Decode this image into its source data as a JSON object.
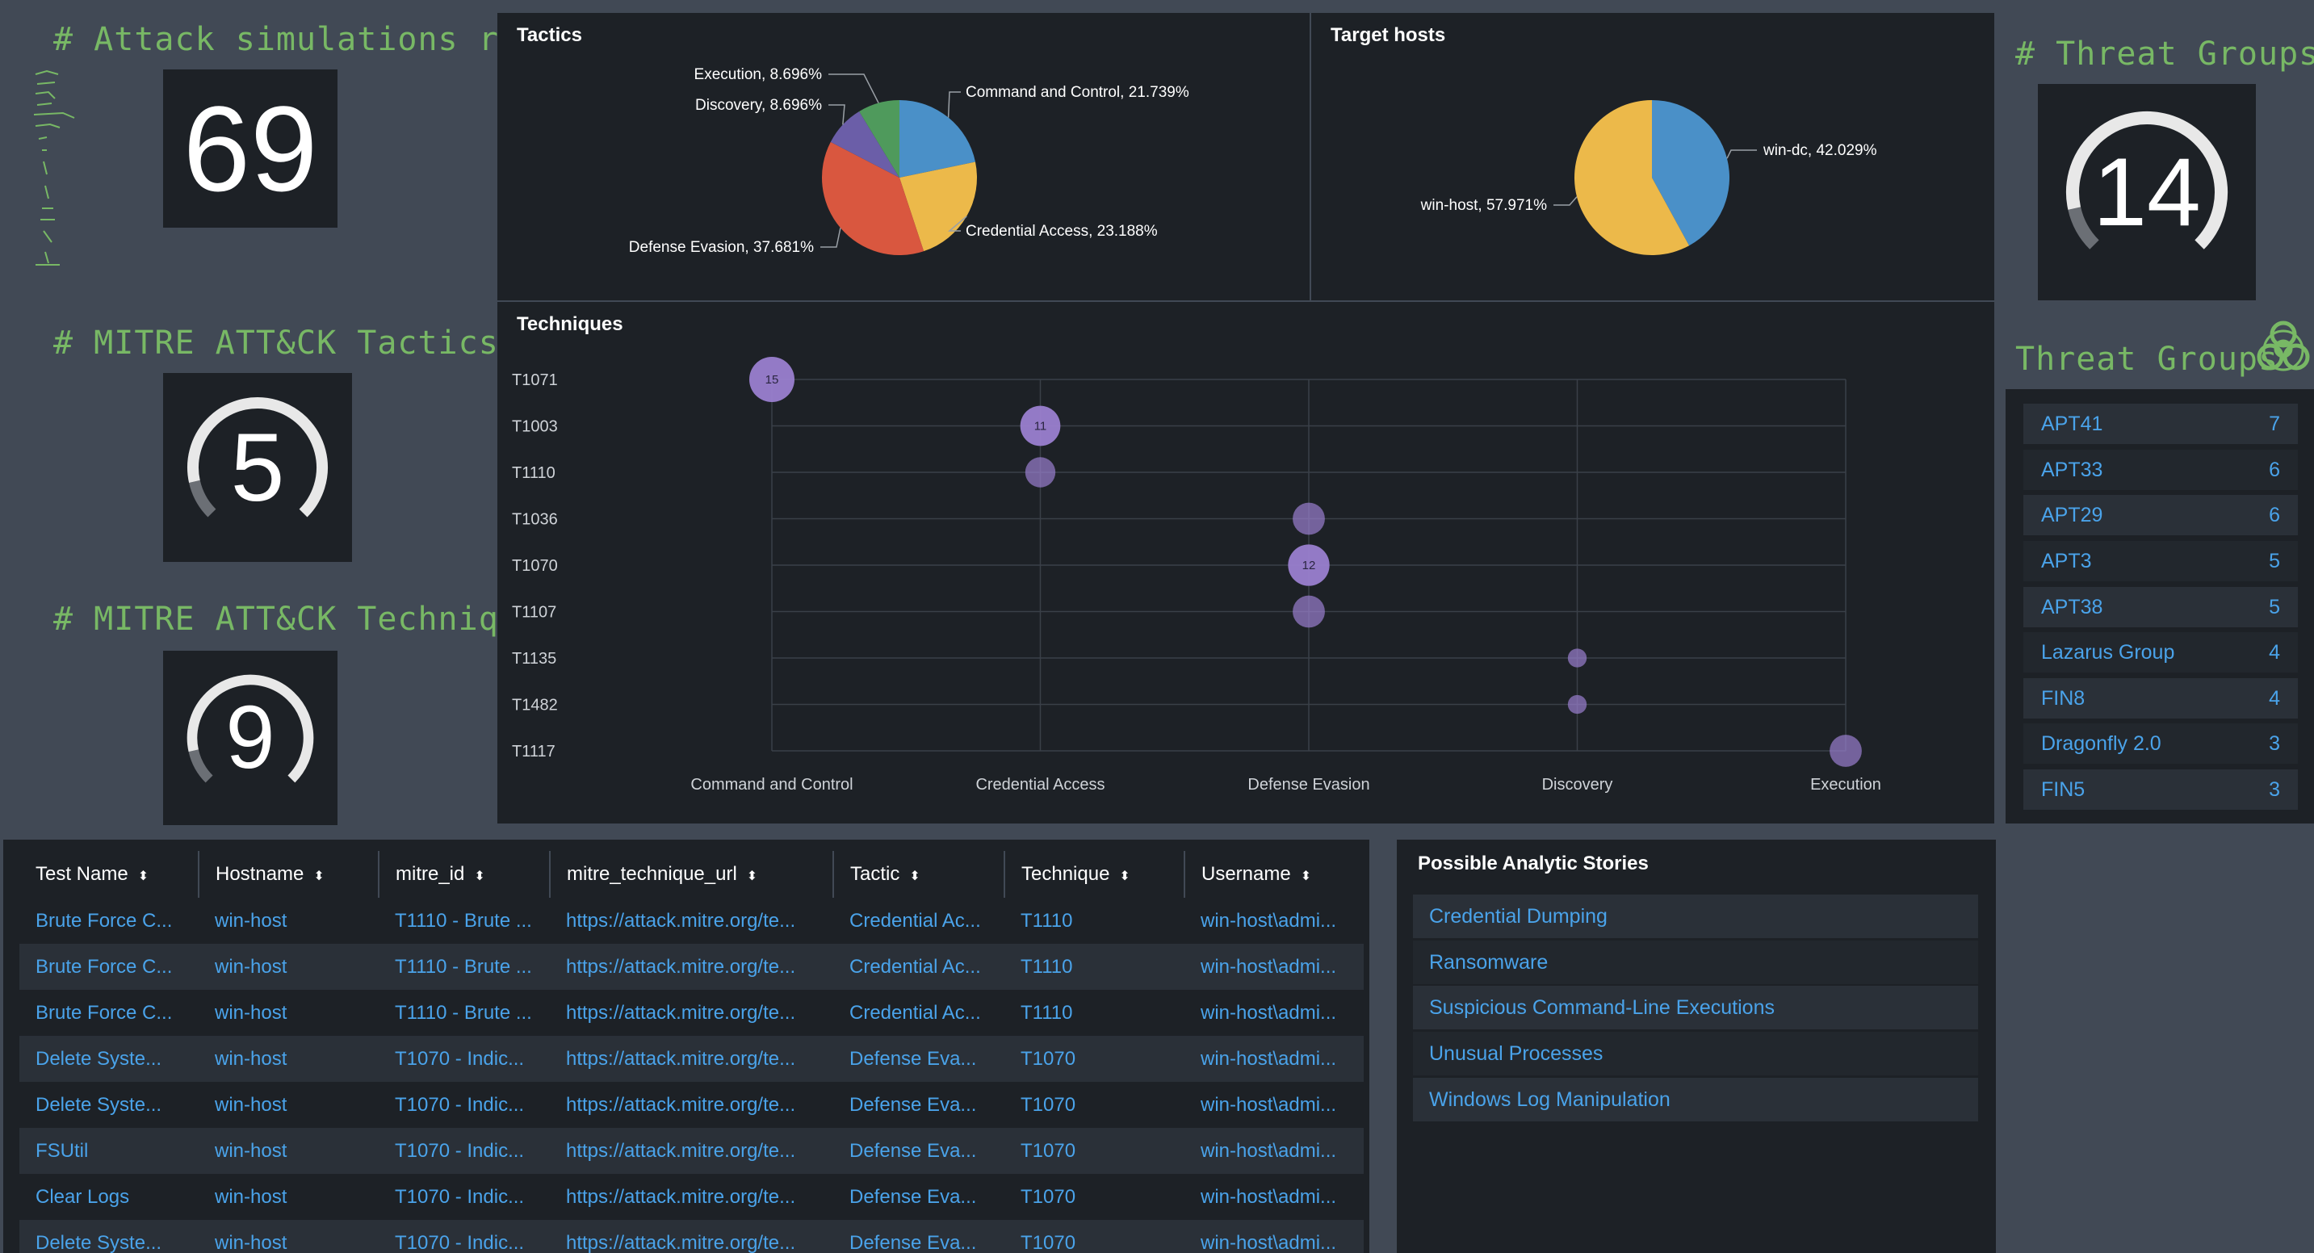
{
  "kpis": {
    "attack_sims": {
      "title": "# Attack simulations run",
      "value": "69"
    },
    "tactics": {
      "title": "# MITRE ATT&CK Tactics",
      "value": "5",
      "fraction": 0.88
    },
    "techniques": {
      "title": "# MITRE ATT&CK Techniques",
      "value": "9",
      "fraction": 0.88
    },
    "threat_groups": {
      "title": "# Threat Groups",
      "value": "14",
      "fraction": 0.88
    }
  },
  "colors": {
    "accent_green": "#78b865",
    "link_blue": "#4aa3ea",
    "pie_blue": "#4a90c8",
    "pie_yellow": "#ecb94a",
    "pie_red": "#d9573f",
    "pie_purple": "#6b5ea8",
    "pie_green": "#4f9a5c",
    "bubble": "#9a7fcf"
  },
  "tactics_panel": {
    "title": "Tactics",
    "chart_data": {
      "type": "pie",
      "slices": [
        {
          "label": "Command and Control, 21.739%",
          "value": 21.739,
          "color": "#4a90c8"
        },
        {
          "label": "Credential Access, 23.188%",
          "value": 23.188,
          "color": "#ecb94a"
        },
        {
          "label": "Defense Evasion, 37.681%",
          "value": 37.681,
          "color": "#d9573f"
        },
        {
          "label": "Discovery, 8.696%",
          "value": 8.696,
          "color": "#6b5ea8"
        },
        {
          "label": "Execution, 8.696%",
          "value": 8.696,
          "color": "#4f9a5c"
        }
      ]
    }
  },
  "hosts_panel": {
    "title": "Target hosts",
    "chart_data": {
      "type": "pie",
      "slices": [
        {
          "label": "win-dc, 42.029%",
          "value": 42.029,
          "color": "#4a90c8"
        },
        {
          "label": "win-host, 57.971%",
          "value": 57.971,
          "color": "#ecb94a"
        }
      ]
    }
  },
  "techniques_panel": {
    "title": "Techniques",
    "chart_data": {
      "type": "scatter",
      "x_categories": [
        "Command and Control",
        "Credential Access",
        "Defense Evasion",
        "Discovery",
        "Execution"
      ],
      "y_categories": [
        "T1071",
        "T1003",
        "T1110",
        "T1036",
        "T1070",
        "T1107",
        "T1135",
        "T1482",
        "T1117"
      ],
      "points": [
        {
          "x": "Command and Control",
          "y": "T1071",
          "size": 15,
          "label": "15"
        },
        {
          "x": "Credential Access",
          "y": "T1003",
          "size": 11,
          "label": "11"
        },
        {
          "x": "Credential Access",
          "y": "T1110",
          "size": 5,
          "label": ""
        },
        {
          "x": "Defense Evasion",
          "y": "T1036",
          "size": 6,
          "label": ""
        },
        {
          "x": "Defense Evasion",
          "y": "T1070",
          "size": 12,
          "label": "12"
        },
        {
          "x": "Defense Evasion",
          "y": "T1107",
          "size": 6,
          "label": ""
        },
        {
          "x": "Discovery",
          "y": "T1135",
          "size": 1,
          "label": ""
        },
        {
          "x": "Discovery",
          "y": "T1482",
          "size": 1,
          "label": ""
        },
        {
          "x": "Execution",
          "y": "T1117",
          "size": 6,
          "label": ""
        }
      ],
      "grid": true
    }
  },
  "threat_groups_list": {
    "title": "Threat Groups",
    "icon": "biohazard-icon",
    "items": [
      {
        "name": "APT41",
        "count": "7"
      },
      {
        "name": "APT33",
        "count": "6"
      },
      {
        "name": "APT29",
        "count": "6"
      },
      {
        "name": "APT3",
        "count": "5"
      },
      {
        "name": "APT38",
        "count": "5"
      },
      {
        "name": "Lazarus Group",
        "count": "4"
      },
      {
        "name": "FIN8",
        "count": "4"
      },
      {
        "name": "Dragonfly 2.0",
        "count": "3"
      },
      {
        "name": "FIN5",
        "count": "3"
      }
    ]
  },
  "results_table": {
    "columns": [
      "Test Name",
      "Hostname",
      "mitre_id",
      "mitre_technique_url",
      "Tactic",
      "Technique",
      "Username"
    ],
    "rows": [
      [
        "Brute Force C...",
        "win-host",
        "T1110 - Brute ...",
        "https://attack.mitre.org/te...",
        "Credential Ac...",
        "T1110",
        "win-host\\admi..."
      ],
      [
        "Brute Force C...",
        "win-host",
        "T1110 - Brute ...",
        "https://attack.mitre.org/te...",
        "Credential Ac...",
        "T1110",
        "win-host\\admi..."
      ],
      [
        "Brute Force C...",
        "win-host",
        "T1110 - Brute ...",
        "https://attack.mitre.org/te...",
        "Credential Ac...",
        "T1110",
        "win-host\\admi..."
      ],
      [
        "Delete Syste...",
        "win-host",
        "T1070 - Indic...",
        "https://attack.mitre.org/te...",
        "Defense Eva...",
        "T1070",
        "win-host\\admi..."
      ],
      [
        "Delete Syste...",
        "win-host",
        "T1070 - Indic...",
        "https://attack.mitre.org/te...",
        "Defense Eva...",
        "T1070",
        "win-host\\admi..."
      ],
      [
        "FSUtil",
        "win-host",
        "T1070 - Indic...",
        "https://attack.mitre.org/te...",
        "Defense Eva...",
        "T1070",
        "win-host\\admi..."
      ],
      [
        "Clear Logs",
        "win-host",
        "T1070 - Indic...",
        "https://attack.mitre.org/te...",
        "Defense Eva...",
        "T1070",
        "win-host\\admi..."
      ],
      [
        "Delete Syste...",
        "win-host",
        "T1070 - Indic...",
        "https://attack.mitre.org/te...",
        "Defense Eva...",
        "T1070",
        "win-host\\admi..."
      ]
    ]
  },
  "stories_panel": {
    "title": "Possible Analytic Stories",
    "items": [
      "Credential Dumping",
      "Ransomware",
      "Suspicious Command-Line Executions",
      "Unusual Processes",
      "Windows Log Manipulation"
    ]
  }
}
